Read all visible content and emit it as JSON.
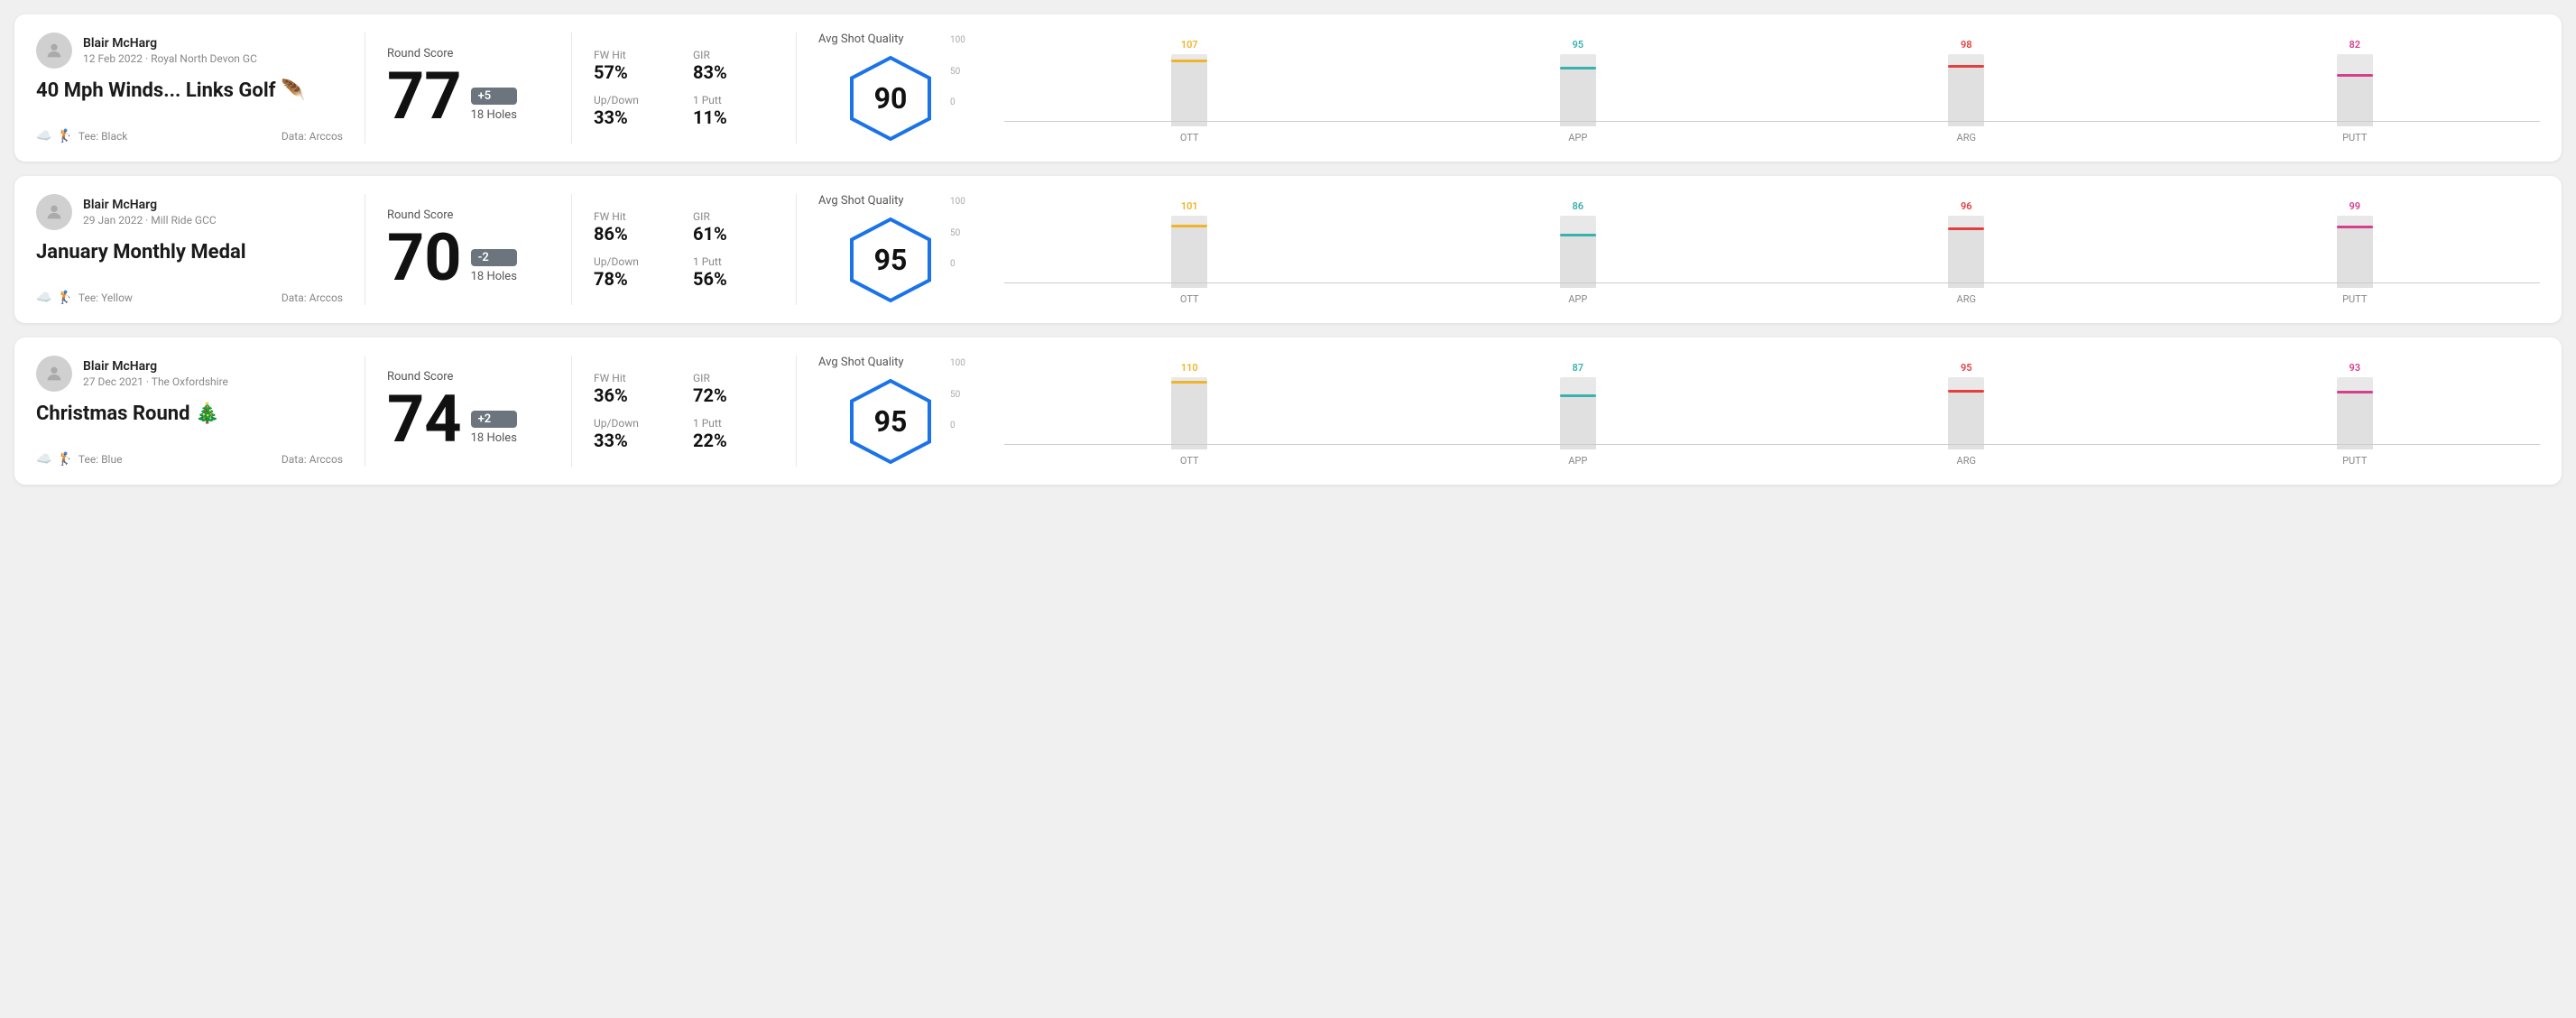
{
  "rounds": [
    {
      "id": "round-1",
      "user": {
        "name": "Blair McHarg",
        "date": "12 Feb 2022",
        "venue": "Royal North Devon GC"
      },
      "title": "40 Mph Winds... Links Golf 🪶",
      "tee": "Black",
      "data_source": "Arccos",
      "score": {
        "label": "Round Score",
        "number": "77",
        "badge": "+5",
        "badge_type": "plus",
        "holes": "18 Holes"
      },
      "stats": {
        "fw_hit_label": "FW Hit",
        "fw_hit_value": "57%",
        "gir_label": "GIR",
        "gir_value": "83%",
        "updown_label": "Up/Down",
        "updown_value": "33%",
        "oneputt_label": "1 Putt",
        "oneputt_value": "11%"
      },
      "quality": {
        "label": "Avg Shot Quality",
        "score": "90"
      },
      "chart": {
        "bars": [
          {
            "label": "OTT",
            "value": 107,
            "color": "#f0b429",
            "max": 120
          },
          {
            "label": "APP",
            "value": 95,
            "color": "#38b2ac",
            "max": 120
          },
          {
            "label": "ARG",
            "value": 98,
            "color": "#e53e3e",
            "max": 120
          },
          {
            "label": "PUTT",
            "value": 82,
            "color": "#d53f8c",
            "max": 120
          }
        ],
        "y_labels": [
          "100",
          "50",
          "0"
        ]
      }
    },
    {
      "id": "round-2",
      "user": {
        "name": "Blair McHarg",
        "date": "29 Jan 2022",
        "venue": "Mill Ride GCC"
      },
      "title": "January Monthly Medal",
      "tee": "Yellow",
      "data_source": "Arccos",
      "score": {
        "label": "Round Score",
        "number": "70",
        "badge": "-2",
        "badge_type": "minus",
        "holes": "18 Holes"
      },
      "stats": {
        "fw_hit_label": "FW Hit",
        "fw_hit_value": "86%",
        "gir_label": "GIR",
        "gir_value": "61%",
        "updown_label": "Up/Down",
        "updown_value": "78%",
        "oneputt_label": "1 Putt",
        "oneputt_value": "56%"
      },
      "quality": {
        "label": "Avg Shot Quality",
        "score": "95"
      },
      "chart": {
        "bars": [
          {
            "label": "OTT",
            "value": 101,
            "color": "#f0b429",
            "max": 120
          },
          {
            "label": "APP",
            "value": 86,
            "color": "#38b2ac",
            "max": 120
          },
          {
            "label": "ARG",
            "value": 96,
            "color": "#e53e3e",
            "max": 120
          },
          {
            "label": "PUTT",
            "value": 99,
            "color": "#d53f8c",
            "max": 120
          }
        ],
        "y_labels": [
          "100",
          "50",
          "0"
        ]
      }
    },
    {
      "id": "round-3",
      "user": {
        "name": "Blair McHarg",
        "date": "27 Dec 2021",
        "venue": "The Oxfordshire"
      },
      "title": "Christmas Round 🎄",
      "tee": "Blue",
      "data_source": "Arccos",
      "score": {
        "label": "Round Score",
        "number": "74",
        "badge": "+2",
        "badge_type": "plus",
        "holes": "18 Holes"
      },
      "stats": {
        "fw_hit_label": "FW Hit",
        "fw_hit_value": "36%",
        "gir_label": "GIR",
        "gir_value": "72%",
        "updown_label": "Up/Down",
        "updown_value": "33%",
        "oneputt_label": "1 Putt",
        "oneputt_value": "22%"
      },
      "quality": {
        "label": "Avg Shot Quality",
        "score": "95"
      },
      "chart": {
        "bars": [
          {
            "label": "OTT",
            "value": 110,
            "color": "#f0b429",
            "max": 120
          },
          {
            "label": "APP",
            "value": 87,
            "color": "#38b2ac",
            "max": 120
          },
          {
            "label": "ARG",
            "value": 95,
            "color": "#e53e3e",
            "max": 120
          },
          {
            "label": "PUTT",
            "value": 93,
            "color": "#d53f8c",
            "max": 120
          }
        ],
        "y_labels": [
          "100",
          "50",
          "0"
        ]
      }
    }
  ],
  "ui": {
    "tee_prefix": "Tee:",
    "data_prefix": "Data:",
    "avatar_symbol": "👤"
  }
}
